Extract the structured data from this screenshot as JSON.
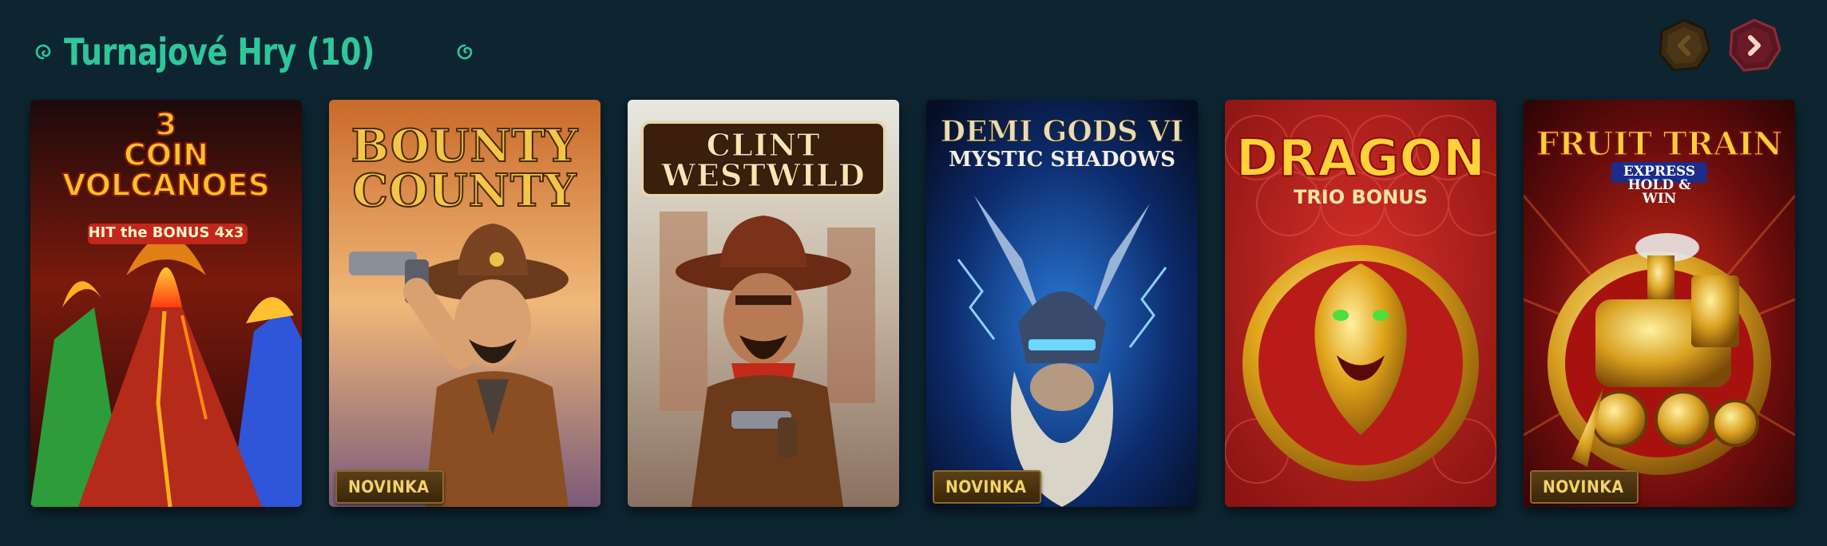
{
  "section": {
    "title": "Turnajové Hry (10)",
    "colors": {
      "background": "#0d2531",
      "title": "#2fc79a",
      "nav_prev": "#3a2a12",
      "nav_next": "#5a1620",
      "badge_text": "#f2d36a"
    }
  },
  "nav": {
    "prev_icon": "chevron-left-icon",
    "next_icon": "chevron-right-icon"
  },
  "games": [
    {
      "title": "3\nCOIN\nVOLCANOES",
      "subtitle": "HIT the BONUS 4x3",
      "badge": ""
    },
    {
      "title": "BOUNTY\nCOUNTY",
      "subtitle": "",
      "badge": "NOVINKA"
    },
    {
      "title": "CLINT\nWESTWILD",
      "subtitle": "",
      "badge": ""
    },
    {
      "title": "DEMI GODS VI",
      "subtitle": "MYSTIC SHADOWS",
      "badge": "NOVINKA"
    },
    {
      "title": "DRAGON",
      "subtitle": "TRIO BONUS",
      "badge": ""
    },
    {
      "title": "FRUIT TRAIN",
      "subtitle": "EXPRESS HOLD & WIN",
      "badge": "NOVINKA"
    }
  ]
}
